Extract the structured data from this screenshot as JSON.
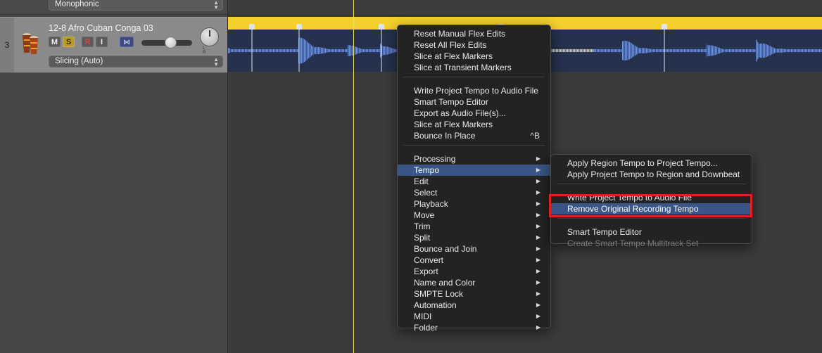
{
  "tracks": {
    "previous": {
      "mode": "Monophonic"
    },
    "current": {
      "number": "3",
      "name": "12-8 Afro Cuban Conga 03",
      "buttons": {
        "mute": "M",
        "solo": "S",
        "record": "R",
        "input": "I"
      },
      "pan_labels": "L R",
      "mode": "Slicing (Auto)"
    }
  },
  "context_menu": {
    "group1": [
      "Reset Manual Flex Edits",
      "Reset All Flex Edits",
      "Slice at Flex Markers",
      "Slice at Transient Markers"
    ],
    "group2": [
      {
        "label": "Write Project Tempo to Audio File",
        "shortcut": ""
      },
      {
        "label": "Smart Tempo Editor",
        "shortcut": ""
      },
      {
        "label": "Export as Audio File(s)...",
        "shortcut": ""
      },
      {
        "label": "Slice at Flex Markers",
        "shortcut": ""
      },
      {
        "label": "Bounce In Place",
        "shortcut": "^B"
      }
    ],
    "submenus": [
      "Processing",
      "Tempo",
      "Edit",
      "Select",
      "Playback",
      "Move",
      "Trim",
      "Split",
      "Bounce and Join",
      "Convert",
      "Export",
      "Name and Color",
      "SMPTE Lock",
      "Automation",
      "MIDI",
      "Folder"
    ],
    "active_item": "Tempo"
  },
  "tempo_submenu": {
    "group1": [
      "Apply Region Tempo to Project Tempo...",
      "Apply Project Tempo to Region and Downbeat"
    ],
    "group2": [
      "Write Project Tempo to Audio File",
      "Remove Original Recording Tempo"
    ],
    "group3": [
      "Smart Tempo Editor",
      "Create Smart Tempo Multitrack Set"
    ],
    "highlighted_item": "Remove Original Recording Tempo",
    "disabled_item": "Create Smart Tempo Multitrack Set"
  },
  "colors": {
    "region_header": "#f3d02b",
    "waveform": "#6f8fd6",
    "menu_highlight": "#3a5686",
    "annotation_box": "#e02020"
  }
}
